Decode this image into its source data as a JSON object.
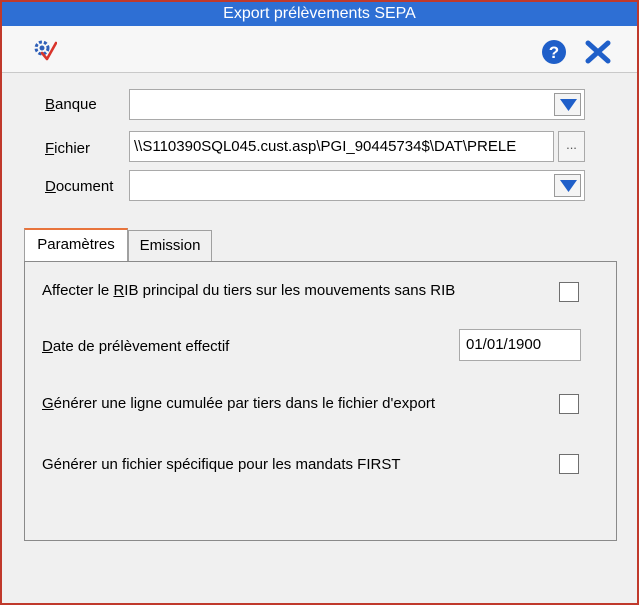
{
  "window": {
    "title": "Export prélèvements SEPA"
  },
  "toolbar": {
    "app_icon": "validate-gear-icon",
    "help_icon": "help-icon",
    "close_icon": "close-icon"
  },
  "form": {
    "banque": {
      "label_u": "B",
      "label_rest": "anque",
      "value": ""
    },
    "fichier": {
      "label_u": "F",
      "label_rest": "ichier",
      "value": "\\\\S110390SQL045.cust.asp\\PGI_90445734$\\DAT\\PRELE",
      "browse_label": "..."
    },
    "document": {
      "label_u": "D",
      "label_rest": "ocument",
      "value": ""
    }
  },
  "tabs": [
    {
      "label": "Paramètres",
      "active": true
    },
    {
      "label": "Emission",
      "active": false
    }
  ],
  "parametres": {
    "opt_rib": {
      "pre": "Affecter le ",
      "u": "R",
      "post": "IB principal du tiers sur les mouvements sans RIB",
      "checked": false
    },
    "opt_date": {
      "u": "D",
      "post": "ate de prélèvement effectif",
      "value": "01/01/1900"
    },
    "opt_cumul": {
      "u": "G",
      "post": "énérer une ligne cumulée par tiers dans le fichier d'export",
      "checked": false
    },
    "opt_first": {
      "label": "Générer un fichier spécifique pour les mandats FIRST",
      "checked": false
    }
  },
  "colors": {
    "titlebar": "#2e6fd4",
    "accent_blue": "#1f5fc9",
    "window_border": "#c0392b",
    "active_tab": "#e8743c"
  }
}
